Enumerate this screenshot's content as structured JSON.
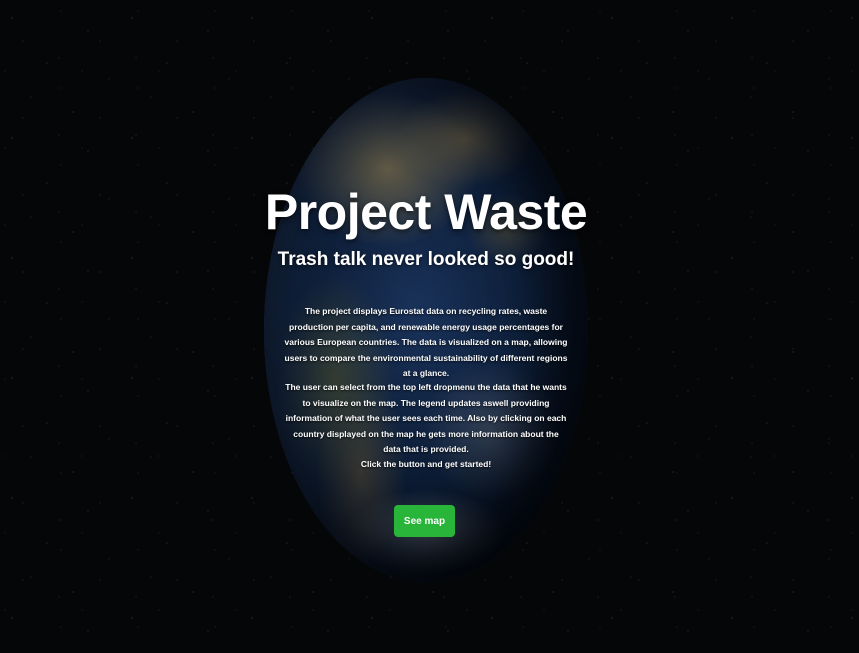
{
  "hero": {
    "title": "Project Waste",
    "subtitle": "Trash talk never looked so good!",
    "paragraphs": [
      "The project displays Eurostat data on recycling rates, waste production per capita, and renewable energy usage percentages for various European countries. The data is visualized on a map, allowing users to compare the environmental sustainability of different regions at a glance.",
      "The user can select from the top left dropmenu the data that he wants to visualize on the map. The legend updates aswell providing information of what the user sees each time. Also by clicking on each country displayed on the map he gets more information about the data that is provided.",
      "Click the button and get started!"
    ],
    "button_label": "See map"
  },
  "colors": {
    "background": "#000000",
    "button": "#28b53a",
    "text": "#ffffff"
  }
}
